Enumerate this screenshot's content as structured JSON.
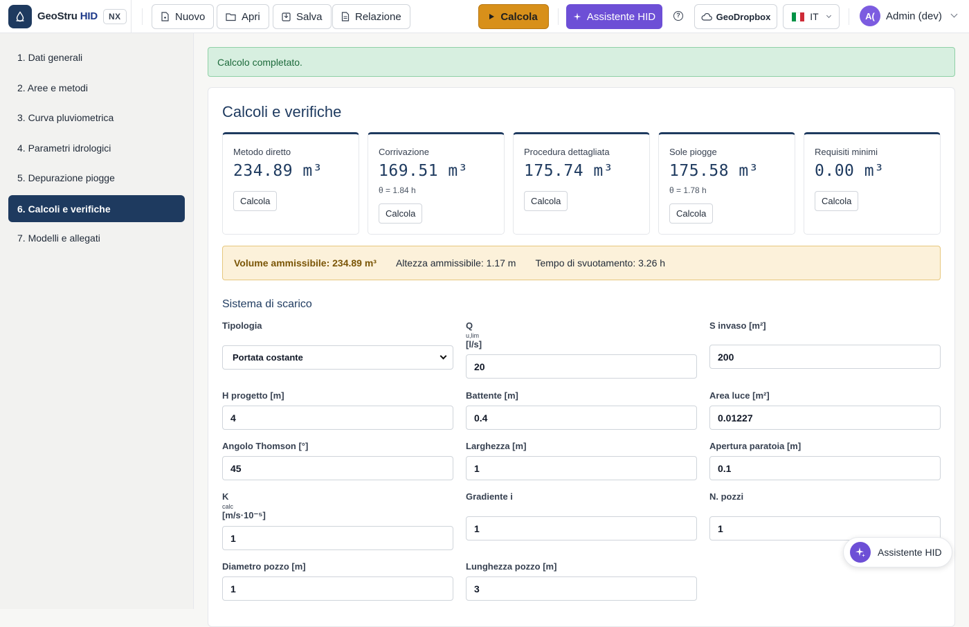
{
  "brand": {
    "name": "GeoStru",
    "name_accent": "HID",
    "badge": "NX"
  },
  "toolbar": {
    "new_label": "Nuovo",
    "open_label": "Apri",
    "save_label": "Salva",
    "report_label": "Relazione",
    "calculate_label": "Calcola",
    "assistant_label": "Assistente HID",
    "help_glyph": "?",
    "cloud_label": "GeoDropbox",
    "language_label": "IT"
  },
  "user": {
    "initials": "A(",
    "name": "Admin (dev)"
  },
  "sidebar": {
    "items": [
      {
        "label": "1. Dati generali"
      },
      {
        "label": "2. Aree e metodi"
      },
      {
        "label": "3. Curva pluviometrica"
      },
      {
        "label": "4. Parametri idrologici"
      },
      {
        "label": "5. Depurazione piogge"
      },
      {
        "label": "6. Calcoli e verifiche"
      },
      {
        "label": "7. Modelli e allegati"
      }
    ]
  },
  "alert": {
    "text": "Calcolo completato."
  },
  "main": {
    "title": "Calcoli e verifiche",
    "cards": [
      {
        "label": "Metodo diretto",
        "value": "234.89 m³",
        "sub": "",
        "button": "Calcola"
      },
      {
        "label": "Corrivazione",
        "value": "169.51 m³",
        "sub": "θ = 1.84 h",
        "button": "Calcola"
      },
      {
        "label": "Procedura dettagliata",
        "value": "175.74 m³",
        "sub": "",
        "button": "Calcola"
      },
      {
        "label": "Sole piogge",
        "value": "175.58 m³",
        "sub": "θ = 1.78 h",
        "button": "Calcola"
      },
      {
        "label": "Requisiti minimi",
        "value": "0.00 m³",
        "sub": "",
        "button": "Calcola"
      }
    ],
    "summary": {
      "volume": "Volume ammissibile: 234.89 m³",
      "height": "Altezza ammissibile: 1.17 m",
      "emptying": "Tempo di svuotamento: 3.26 h"
    },
    "section_title": "Sistema di scarico",
    "fields": {
      "tipologia": {
        "label": "Tipologia",
        "value": "Portata costante"
      },
      "q": {
        "label": "Q",
        "sub": "u,lim",
        "unit": "[l/s]",
        "value": "20"
      },
      "s_invaso": {
        "label": "S invaso [m²]",
        "value": "200"
      },
      "h_progetto": {
        "label": "H progetto [m]",
        "value": "4"
      },
      "battente": {
        "label": "Battente [m]",
        "value": "0.4"
      },
      "area_luce": {
        "label": "Area luce [m²]",
        "value": "0.01227"
      },
      "angolo": {
        "label": "Angolo Thomson [°]",
        "value": "45"
      },
      "larghezza": {
        "label": "Larghezza [m]",
        "value": "1"
      },
      "apertura": {
        "label": "Apertura paratoia [m]",
        "value": "0.1"
      },
      "k": {
        "label": "K",
        "sub": "calc",
        "unit": "[m/s·10⁻⁵]",
        "value": "1"
      },
      "gradiente": {
        "label": "Gradiente i",
        "value": "1"
      },
      "n_pozzi": {
        "label": "N. pozzi",
        "value": "1"
      },
      "diametro": {
        "label": "Diametro pozzo [m]",
        "value": "1"
      },
      "lunghezza": {
        "label": "Lunghezza pozzo [m]",
        "value": "3"
      }
    }
  },
  "fab": {
    "label": "Assistente HID"
  },
  "colors": {
    "primary": "#1e3a5f",
    "accent": "#d8901a",
    "assistant": "#6d4fd6",
    "success_bg": "#d7efe0",
    "warning_bg": "#fcf1da"
  }
}
